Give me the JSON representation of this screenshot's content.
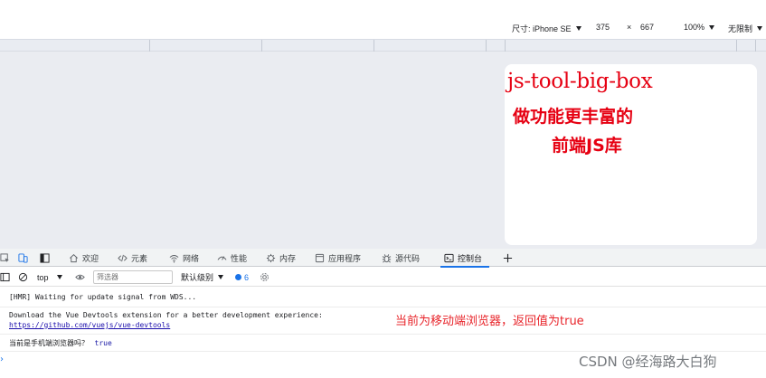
{
  "device_toolbar": {
    "device_label": "尺寸: iPhone SE",
    "width": "375",
    "times": "×",
    "height": "667",
    "zoom": "100%",
    "throttle": "无限制"
  },
  "device_screen": {
    "title": "js-tool-big-box",
    "subtitle_line1": "做功能更丰富的",
    "subtitle_line2": "前端JS库"
  },
  "devtools_tabs": [
    {
      "label": "欢迎",
      "icon": "home-icon"
    },
    {
      "label": "元素",
      "icon": "code-icon"
    },
    {
      "label": "网络",
      "icon": "wifi-icon"
    },
    {
      "label": "性能",
      "icon": "performance-icon"
    },
    {
      "label": "内存",
      "icon": "memory-icon"
    },
    {
      "label": "应用程序",
      "icon": "application-icon"
    },
    {
      "label": "源代码",
      "icon": "bug-icon"
    },
    {
      "label": "控制台",
      "icon": "console-icon",
      "active": true
    }
  ],
  "console_toolbar": {
    "context": "top",
    "filter_placeholder": "筛选器",
    "level": "默认级别",
    "issues_count": "6"
  },
  "console_messages": {
    "hmr": "[HMR] Waiting for update signal from WDS...",
    "devtools_line1": "Download the Vue Devtools extension for a better development experience:",
    "devtools_link": "https://github.com/vuejs/vue-devtools",
    "question": "当前是手机端浏览器吗？",
    "result": "true"
  },
  "annotation": "当前为移动端浏览器，返回值为true",
  "watermark": "CSDN @经海路大白狗",
  "colors": {
    "accent": "#1a73e8",
    "hero_red": "#e60012",
    "annotation_red": "#e8242a"
  }
}
